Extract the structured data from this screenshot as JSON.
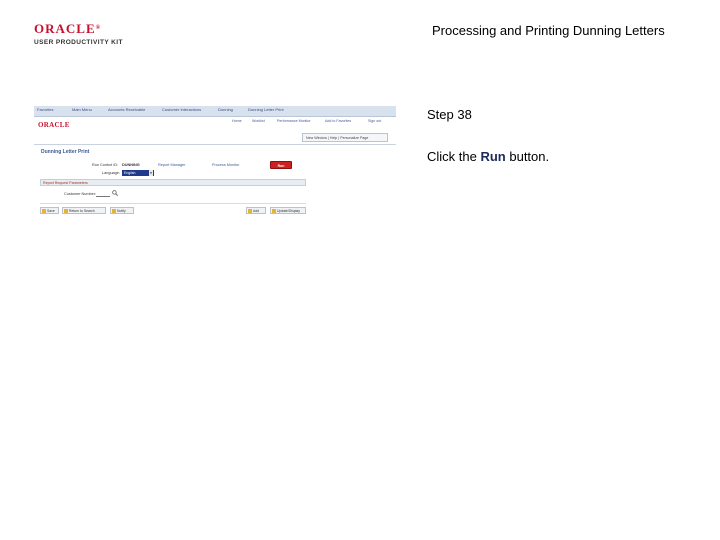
{
  "logo": {
    "brand": "ORACLE",
    "registered": "®",
    "subtitle": "USER PRODUCTIVITY KIT"
  },
  "document_title": "Processing and Printing Dunning Letters",
  "step_label": "Step 38",
  "instruction": {
    "prefix": "Click the ",
    "emphasis": "Run",
    "suffix": " button."
  },
  "screenshot": {
    "top_nav": [
      "Favorites",
      "Main Menu",
      "Accounts Receivable",
      "Customer Interactions",
      "Dunning",
      "Dunning Letter Print"
    ],
    "brand": "ORACLE",
    "header_links": [
      "Home",
      "Worklist",
      "Performance Monitor",
      "Add to Favorites",
      "Sign out"
    ],
    "personalize_text": "New Window | Help | Personalize Page",
    "page_title": "Dunning Letter Print",
    "run_control_label": "Run Control ID:",
    "run_control_value": "DUNNING",
    "report_manager_link": "Report Manager",
    "process_monitor_link": "Process Monitor",
    "run_button": "Run",
    "language_label": "Language:",
    "language_value": "English",
    "section_title": "Report Request Parameters",
    "customer_label": "Customer Number:",
    "bottom_buttons": [
      "Save",
      "Return to Search",
      "Notify"
    ],
    "add_button": "Add",
    "update_display": "Update/Display"
  }
}
